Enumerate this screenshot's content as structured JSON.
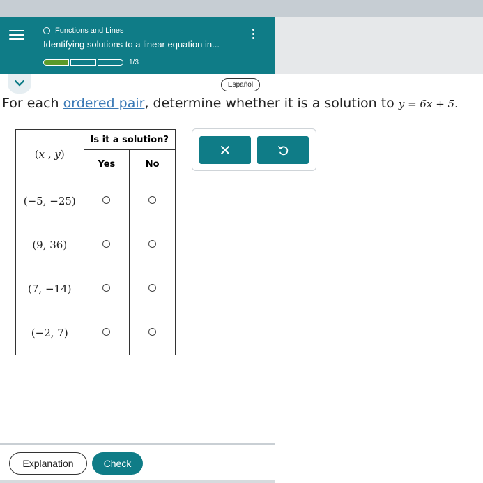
{
  "header": {
    "topic": "Functions and Lines",
    "title": "Identifying solutions to a linear equation in...",
    "progress_text": "1/3",
    "progress": {
      "completed": 1,
      "total": 3
    }
  },
  "language_button": "Español",
  "question": {
    "prefix": "For each ",
    "link": "ordered pair",
    "suffix": ", determine whether it is a solution to ",
    "equation_y": "y",
    "equation_eq": " = 6",
    "equation_x": "x",
    "equation_rest": " + 5."
  },
  "table": {
    "header_top": "Is it a solution?",
    "pair_header": "(x , y)",
    "pair_header_x": "x",
    "pair_header_y": "y",
    "col_yes": "Yes",
    "col_no": "No",
    "rows": [
      {
        "pair": "(−5, −25)"
      },
      {
        "pair": "(9, 36)"
      },
      {
        "pair": "(7, −14)"
      },
      {
        "pair": "(−2, 7)"
      }
    ]
  },
  "tools": {
    "clear_icon": "times-icon",
    "undo_icon": "undo-icon"
  },
  "footer": {
    "explanation": "Explanation",
    "check": "Check"
  },
  "colors": {
    "teal": "#0f7c87",
    "progress_green": "#5b9a2a",
    "link_blue": "#3a79b6"
  }
}
